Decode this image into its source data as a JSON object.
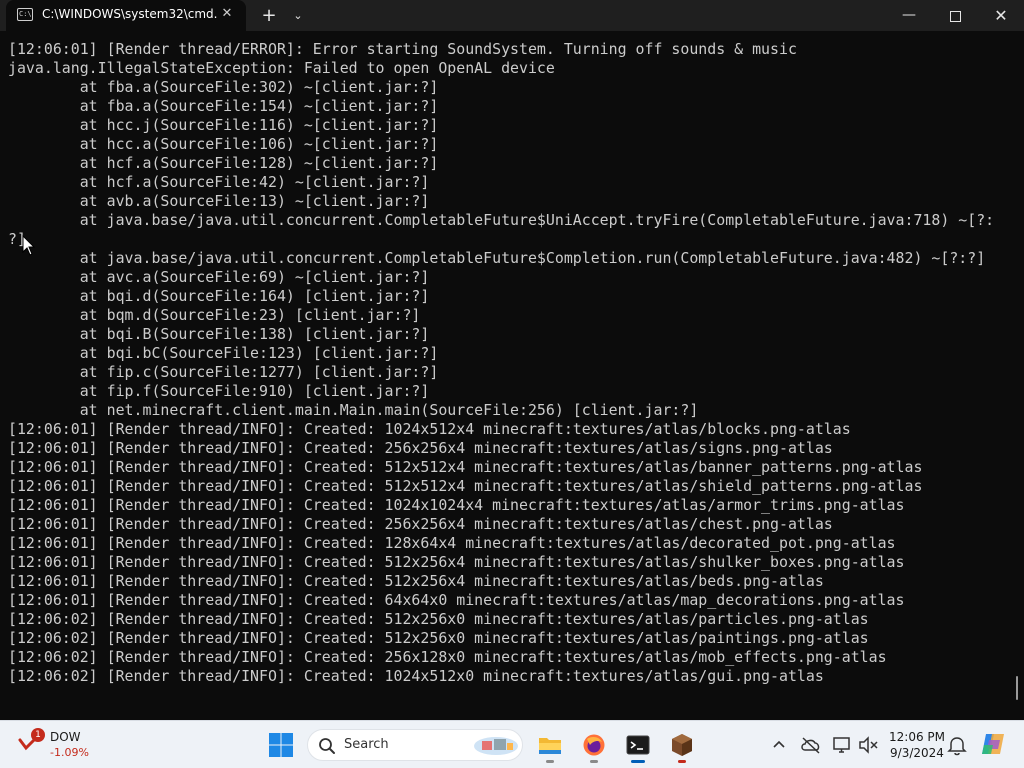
{
  "window": {
    "tab_title": "C:\\WINDOWS\\system32\\cmd.",
    "tab_icon_text": "C:\\",
    "close_tab_glyph": "✕",
    "new_tab_glyph": "+",
    "dropdown_glyph": "⌄",
    "minimize_glyph": "—",
    "close_glyph": "✕"
  },
  "console": {
    "lines": [
      "[12:06:01] [Render thread/ERROR]: Error starting SoundSystem. Turning off sounds & music",
      "java.lang.IllegalStateException: Failed to open OpenAL device",
      "        at fba.a(SourceFile:302) ~[client.jar:?]",
      "        at fba.a(SourceFile:154) ~[client.jar:?]",
      "        at hcc.j(SourceFile:116) ~[client.jar:?]",
      "        at hcc.a(SourceFile:106) ~[client.jar:?]",
      "        at hcf.a(SourceFile:128) ~[client.jar:?]",
      "        at hcf.a(SourceFile:42) ~[client.jar:?]",
      "        at avb.a(SourceFile:13) ~[client.jar:?]",
      "        at java.base/java.util.concurrent.CompletableFuture$UniAccept.tryFire(CompletableFuture.java:718) ~[?:",
      "?]",
      "        at java.base/java.util.concurrent.CompletableFuture$Completion.run(CompletableFuture.java:482) ~[?:?]",
      "        at avc.a(SourceFile:69) ~[client.jar:?]",
      "        at bqi.d(SourceFile:164) [client.jar:?]",
      "        at bqm.d(SourceFile:23) [client.jar:?]",
      "        at bqi.B(SourceFile:138) [client.jar:?]",
      "        at bqi.bC(SourceFile:123) [client.jar:?]",
      "        at fip.c(SourceFile:1277) [client.jar:?]",
      "        at fip.f(SourceFile:910) [client.jar:?]",
      "        at net.minecraft.client.main.Main.main(SourceFile:256) [client.jar:?]",
      "[12:06:01] [Render thread/INFO]: Created: 1024x512x4 minecraft:textures/atlas/blocks.png-atlas",
      "[12:06:01] [Render thread/INFO]: Created: 256x256x4 minecraft:textures/atlas/signs.png-atlas",
      "[12:06:01] [Render thread/INFO]: Created: 512x512x4 minecraft:textures/atlas/banner_patterns.png-atlas",
      "[12:06:01] [Render thread/INFO]: Created: 512x512x4 minecraft:textures/atlas/shield_patterns.png-atlas",
      "[12:06:01] [Render thread/INFO]: Created: 1024x1024x4 minecraft:textures/atlas/armor_trims.png-atlas",
      "[12:06:01] [Render thread/INFO]: Created: 256x256x4 minecraft:textures/atlas/chest.png-atlas",
      "[12:06:01] [Render thread/INFO]: Created: 128x64x4 minecraft:textures/atlas/decorated_pot.png-atlas",
      "[12:06:01] [Render thread/INFO]: Created: 512x256x4 minecraft:textures/atlas/shulker_boxes.png-atlas",
      "[12:06:01] [Render thread/INFO]: Created: 512x256x4 minecraft:textures/atlas/beds.png-atlas",
      "[12:06:01] [Render thread/INFO]: Created: 64x64x0 minecraft:textures/atlas/map_decorations.png-atlas",
      "[12:06:02] [Render thread/INFO]: Created: 512x256x0 minecraft:textures/atlas/particles.png-atlas",
      "[12:06:02] [Render thread/INFO]: Created: 512x256x0 minecraft:textures/atlas/paintings.png-atlas",
      "[12:06:02] [Render thread/INFO]: Created: 256x128x0 minecraft:textures/atlas/mob_effects.png-atlas",
      "[12:06:02] [Render thread/INFO]: Created: 1024x512x0 minecraft:textures/atlas/gui.png-atlas"
    ]
  },
  "taskbar": {
    "widget": {
      "badge": "1",
      "name": "DOW",
      "change": "-1.09%"
    },
    "search_placeholder": "Search",
    "apps": [
      {
        "name": "file-explorer-icon"
      },
      {
        "name": "firefox-icon"
      },
      {
        "name": "terminal-icon",
        "active": true
      },
      {
        "name": "minecraft-launcher-icon"
      }
    ],
    "clock": {
      "time": "12:06 PM",
      "date": "9/3/2024"
    }
  },
  "colors": {
    "console_bg": "#0c0c0c",
    "console_text": "#cccccc",
    "taskbar_bg": "#eef2f7",
    "accent": "#005fb8",
    "negative": "#c42b1c"
  }
}
